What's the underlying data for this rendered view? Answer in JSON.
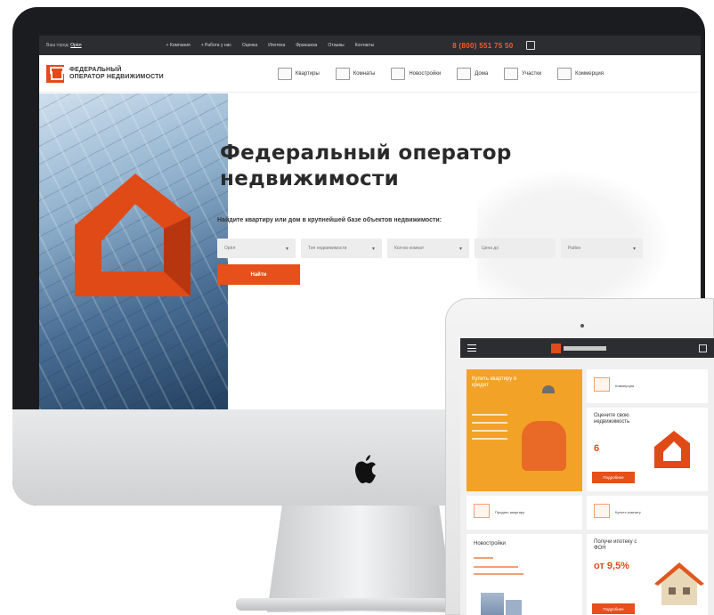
{
  "desktop": {
    "topbar": {
      "city_label": "Ваш город:",
      "city_value": "Орёл",
      "nav": [
        "+ Компания",
        "+ Работа у нас",
        "Оценка",
        "Ипотека",
        "Франшиза",
        "Отзывы",
        "Контакты"
      ],
      "phone": "8 (800) 551 75 50"
    },
    "header": {
      "logo_line1": "ФЕДЕРАЛЬНЫЙ",
      "logo_line2": "ОПЕРАТОР НЕДВИЖИМОСТИ",
      "categories": [
        "Квартиры",
        "Комнаты",
        "Новостройки",
        "Дома",
        "Участки",
        "Коммерция"
      ]
    },
    "hero": {
      "title": "Федеральный оператор недвижимости",
      "subtitle": "Найдите квартиру или дом в крупнейшей базе объектов недвижимости:",
      "filters": [
        {
          "value": "Орёл"
        },
        {
          "value": "Тип недвижимости"
        },
        {
          "value": "Кол-во комнат"
        },
        {
          "value": "Цена до"
        },
        {
          "value": "Район"
        }
      ],
      "find_button": "Найти"
    }
  },
  "tablet": {
    "promo_title": "Купить квартиру в кредит",
    "evaluate_title": "Оцените свою недвижимость",
    "evaluate_price": "6",
    "evaluate_button": "Подробнее",
    "new_buildings_title": "Новостройки",
    "mortgage_title": "Получи ипотеку с ФОН",
    "mortgage_rate": "от 9,5%",
    "mortgage_button": "Подробнее",
    "tiles": [
      "Коммерция",
      "Продать квартиру",
      "Купить комнату"
    ]
  },
  "colors": {
    "accent": "#e5501b",
    "dark_bar": "#2b2d31",
    "promo_orange": "#f2a227"
  }
}
